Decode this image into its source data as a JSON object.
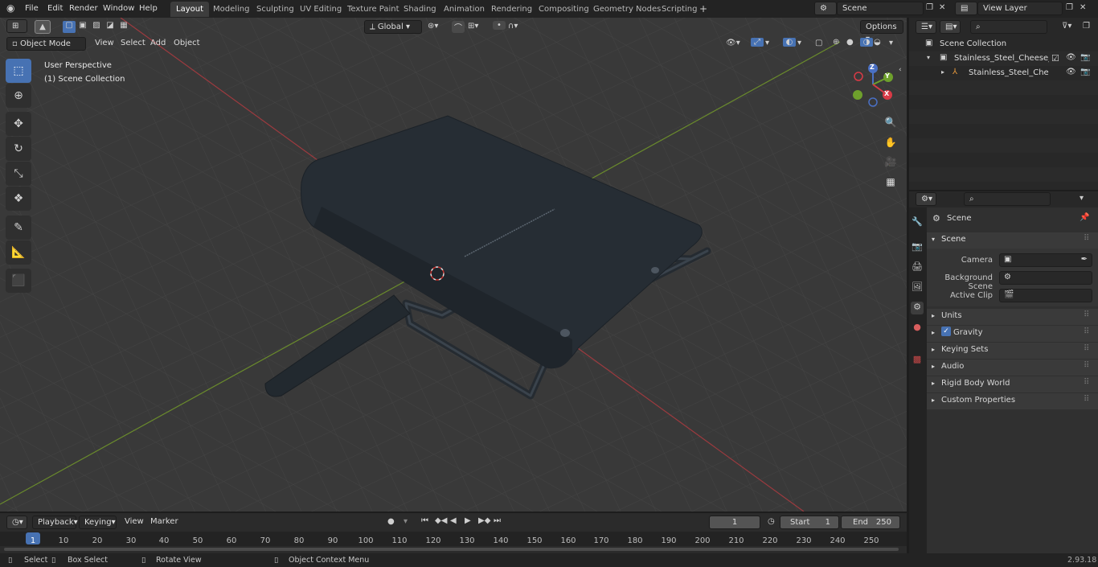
{
  "topbar": {
    "menus": [
      "File",
      "Edit",
      "Render",
      "Window",
      "Help"
    ],
    "workspaces": [
      "Layout",
      "Modeling",
      "Sculpting",
      "UV Editing",
      "Texture Paint",
      "Shading",
      "Animation",
      "Rendering",
      "Compositing",
      "Geometry Nodes",
      "Scripting"
    ],
    "active_workspace": "Layout",
    "scene_name": "Scene",
    "view_layer": "View Layer"
  },
  "viewport": {
    "mode": "Object Mode",
    "menus": [
      "View",
      "Select",
      "Add",
      "Object"
    ],
    "transform_orientation": "Global",
    "options_label": "Options",
    "overlay_title": "User Perspective",
    "overlay_subtitle": "(1) Scene Collection",
    "gizmo_labels": {
      "x": "X",
      "y": "Y",
      "z": "Z"
    },
    "tools": [
      "select-box-icon",
      "cursor-icon",
      "move-icon",
      "rotate-icon",
      "scale-icon",
      "transform-icon",
      "annotate-icon",
      "measure-icon",
      "add-cube-icon"
    ],
    "object_color": "#2a3138",
    "background_color": "#393939",
    "x_axis_color": "#9c3a3f",
    "y_axis_color": "#6a8b2c"
  },
  "timeline": {
    "menus": [
      "Playback",
      "Keying",
      "View",
      "Marker"
    ],
    "current_frame": "1",
    "start_label": "Start",
    "start_value": "1",
    "end_label": "End",
    "end_value": "250",
    "ruler": [
      "1",
      "10",
      "20",
      "30",
      "40",
      "50",
      "60",
      "70",
      "80",
      "90",
      "100",
      "110",
      "120",
      "130",
      "140",
      "150",
      "160",
      "170",
      "180",
      "190",
      "200",
      "210",
      "220",
      "230",
      "240",
      "250"
    ]
  },
  "outliner": {
    "root": "Scene Collection",
    "collection": "Stainless_Steel_Cheese_Cutte",
    "object": "Stainless_Steel_Cheese_("
  },
  "properties": {
    "context": "Scene",
    "panel": "Scene",
    "camera_label": "Camera",
    "bg_scene_label": "Background Scene",
    "active_clip_label": "Active Clip",
    "subpanels": [
      "Units",
      "Gravity",
      "Keying Sets",
      "Audio",
      "Rigid Body World",
      "Custom Properties"
    ],
    "gravity_checked": true
  },
  "statusbar": {
    "items": [
      "Select",
      "Box Select",
      "Rotate View",
      "Object Context Menu"
    ],
    "version": "2.93.18"
  }
}
